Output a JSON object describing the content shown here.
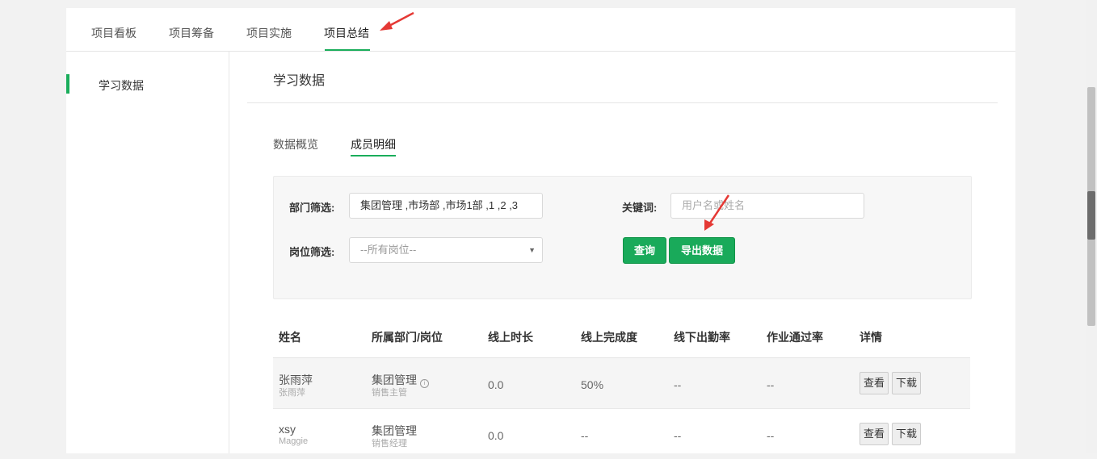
{
  "top_nav": {
    "tabs": [
      "项目看板",
      "项目筹备",
      "项目实施",
      "项目总结"
    ],
    "active_index": 3
  },
  "sidebar": {
    "items": [
      {
        "label": "学习数据"
      }
    ]
  },
  "main": {
    "title": "学习数据",
    "sub_tabs": [
      "数据概览",
      "成员明细"
    ],
    "active_sub_tab": 1
  },
  "filters": {
    "department_label": "部门筛选:",
    "department_value": "集团管理 ,市场部 ,市场1部 ,1 ,2 ,3",
    "position_label": "岗位筛选:",
    "position_value": "--所有岗位--",
    "keyword_label": "关键词:",
    "keyword_placeholder": "用户名或姓名",
    "query_button": "查询",
    "export_button": "导出数据"
  },
  "table": {
    "headers": [
      "姓名",
      "所属部门/岗位",
      "线上时长",
      "线上完成度",
      "线下出勤率",
      "作业通过率",
      "详情"
    ],
    "view_label": "查看",
    "download_label": "下载",
    "rows": [
      {
        "name": "张雨萍",
        "sub_name": "张雨萍",
        "dept": "集团管理",
        "position": "销售主管",
        "online_time": "0.0",
        "completion": "50%",
        "attendance": "--",
        "pass_rate": "--"
      },
      {
        "name": "xsy",
        "sub_name": "Maggie",
        "dept": "集团管理",
        "position": "销售经理",
        "online_time": "0.0",
        "completion": "--",
        "attendance": "--",
        "pass_rate": "--"
      }
    ]
  },
  "colors": {
    "accent": "#1aad5b",
    "annotation": "#e53935"
  }
}
